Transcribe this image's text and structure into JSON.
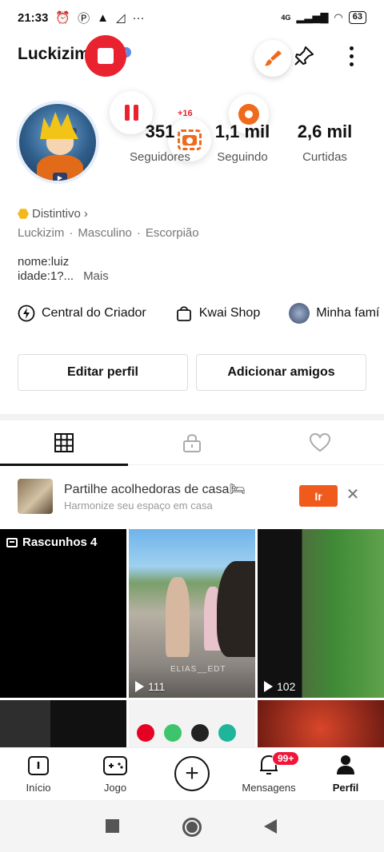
{
  "status_bar": {
    "time": "21:33",
    "network": "4G",
    "battery": "63"
  },
  "header": {
    "username": "Luckizim",
    "tag": "a"
  },
  "profile": {
    "followers_count": "351",
    "followers_label": "Seguidores",
    "following_count": "1,1 mil",
    "following_label": "Seguindo",
    "likes_count": "2,6 mil",
    "likes_label": "Curtidas",
    "badge_overlay": "+16",
    "distintivo": "Distintivo",
    "name": "Luckizim",
    "gender": "Masculino",
    "sign": "Escorpião",
    "bio_line1": "nome:luiz",
    "bio_line2": "idade:1?...",
    "bio_more": "Mais"
  },
  "shortcuts": [
    {
      "label": "Central do Criador",
      "icon": "lightning-icon"
    },
    {
      "label": "Kwai Shop",
      "icon": "shopping-bag-icon"
    },
    {
      "label": "Minha famí",
      "icon": "family-avatar"
    }
  ],
  "buttons": {
    "edit": "Editar perfil",
    "add_friends": "Adicionar amigos"
  },
  "promo": {
    "title": "Partilhe acolhedoras de casa",
    "emoji": "🛏",
    "subtitle": "Harmonize seu espaço em casa",
    "button": "Ir"
  },
  "grid": {
    "drafts_label": "Rascunhos 4",
    "video1_plays": "111",
    "video2_plays": "102",
    "video1_watermark": "ELIAS__EDT"
  },
  "bottom_nav": {
    "home": "Início",
    "game": "Jogo",
    "messages": "Mensagens",
    "messages_badge": "99+",
    "profile": "Perfil"
  },
  "colors": {
    "accent": "#f05a1c",
    "record": "#e8232f",
    "badge": "#f0163a"
  }
}
